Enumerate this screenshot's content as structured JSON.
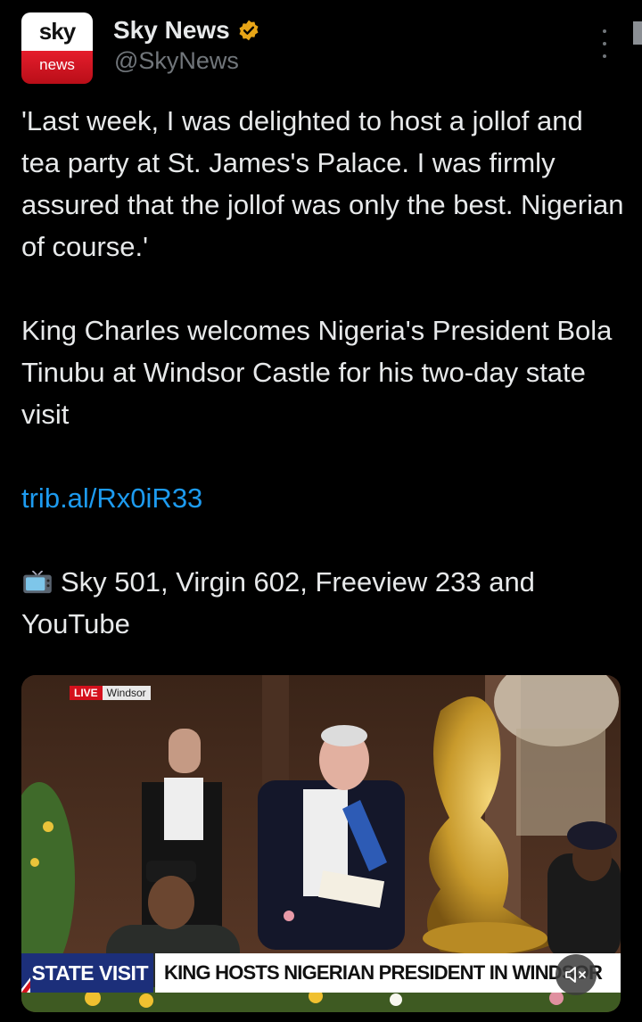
{
  "account": {
    "logo_top": "sky",
    "logo_bottom": "news",
    "name": "Sky News",
    "handle": "@SkyNews",
    "verified_color": "#e8a517"
  },
  "icons": {
    "verified": "verified-badge-icon",
    "more": "more-options-icon",
    "tv": "television-emoji-icon",
    "mute": "muted-speaker-icon"
  },
  "post": {
    "paragraph1": "'Last week, I was delighted to host a jollof and tea party at St. James's Palace. I was firmly assured that the jollof was only the best. Nigerian of course.'",
    "paragraph2": "King Charles welcomes Nigeria's President Bola Tinubu at Windsor Castle for his two-day state visit",
    "link": "trib.al/Rx0iR33",
    "channels": "Sky 501, Virgin 602, Freeview 233 and YouTube"
  },
  "media": {
    "live_label": "LIVE",
    "location_label": "Windsor",
    "ticker_label": "STATE VISIT",
    "ticker_headline": "KING HOSTS NIGERIAN PRESIDENT IN WINDSOR"
  },
  "colors": {
    "link": "#1d9bf0",
    "secondary_text": "#71767b",
    "ticker_blue": "#1c2f7a",
    "live_red": "#d4111d"
  }
}
